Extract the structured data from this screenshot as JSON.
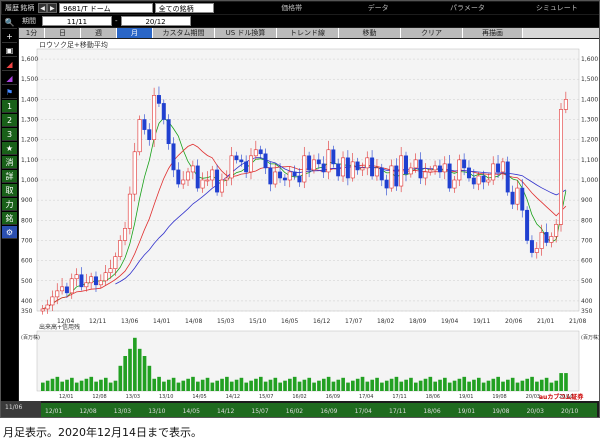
{
  "toolbar": {
    "row1": [
      "履歴",
      "銘柄"
    ],
    "symbol": "9681/T ドーム",
    "universe": "全ての銘柄",
    "tabs": [
      "価格帯",
      "データ",
      "パラメータ",
      "シミュレート"
    ]
  },
  "period": {
    "label": "期間",
    "from": "11/11",
    "to": "20/12"
  },
  "tabbar": {
    "items": [
      "1分",
      "日",
      "週",
      "月",
      "カスタム期間",
      "US ドル換算",
      "トレンド線",
      "移動",
      "クリア",
      "再描画"
    ],
    "active_index": 3
  },
  "sidebar": {
    "items": [
      "🔍",
      "+",
      "▣",
      "◢",
      "◢",
      "⚑",
      "1",
      "2",
      "3",
      "★",
      "消",
      "詳",
      "取",
      "力",
      "銘",
      "⚙"
    ],
    "footer": "11/06"
  },
  "chart_title": "ロウソク足+移動平均",
  "price_axis": {
    "ticks": [
      350,
      400,
      500,
      600,
      700,
      800,
      900,
      1000,
      1100,
      1200,
      1300,
      1400,
      1500,
      1600
    ]
  },
  "volume_label": "出来高+信用残",
  "volume_unit": "(百万株)",
  "x_ticks_top": [
    "12/04",
    "12/11",
    "13/06",
    "14/01",
    "14/08",
    "15/03",
    "15/10",
    "16/05",
    "16/12",
    "17/07",
    "18/02",
    "18/09",
    "19/04",
    "19/11",
    "20/06",
    "21/01",
    "21/08"
  ],
  "x_ticks_bottom": [
    "12/01",
    "12/08",
    "13/03",
    "13/10",
    "14/05",
    "14/12",
    "15/07",
    "16/02",
    "16/09",
    "17/04",
    "17/11",
    "18/06",
    "19/01",
    "19/08",
    "20/03",
    "20/10"
  ],
  "branding": {
    "name": "auカブコム証券",
    "sub": "A member of MUFG"
  },
  "caption": "月足表示。2020年12月14日まで表示。",
  "chart_data": {
    "type": "candlestick",
    "title": "ロウソク足+移動平均",
    "y_range": [
      350,
      1650
    ],
    "series": [
      {
        "name": "close",
        "values": [
          360,
          380,
          420,
          450,
          470,
          440,
          510,
          530,
          470,
          490,
          520,
          480,
          500,
          540,
          560,
          620,
          700,
          760,
          930,
          1140,
          1300,
          1250,
          1200,
          1420,
          1380,
          1300,
          1180,
          1050,
          980,
          1000,
          1040,
          1070,
          960,
          1000,
          1000,
          1050,
          940,
          1000,
          1010,
          1120,
          1100,
          1090,
          1040,
          1120,
          1150,
          1130,
          1060,
          980,
          1040,
          1010,
          1000,
          1040,
          1020,
          990,
          1120,
          1050,
          1100,
          1080,
          1040,
          1150,
          1080,
          1020,
          1110,
          1010,
          1090,
          1050,
          1060,
          1110,
          1020,
          1060,
          1000,
          960,
          1070,
          970,
          1120,
          1030,
          1060,
          1100,
          1010,
          1040,
          1050,
          1070,
          1040,
          1080,
          960,
          1000,
          1100,
          1060,
          1010,
          980,
          1020,
          990,
          1000,
          1080,
          1040,
          1090,
          940,
          880,
          960,
          850,
          700,
          640,
          660,
          740,
          690,
          720,
          780,
          1350,
          1400
        ]
      }
    ]
  }
}
